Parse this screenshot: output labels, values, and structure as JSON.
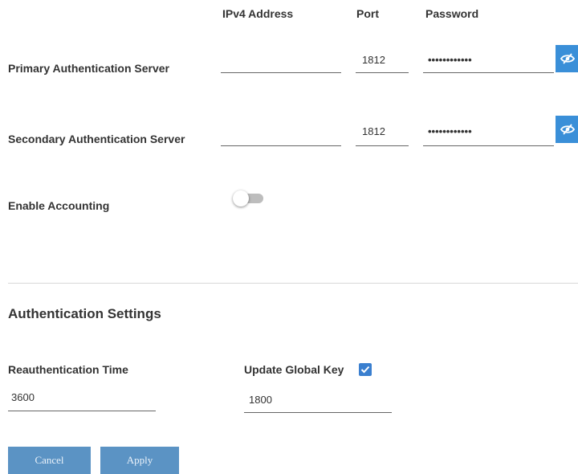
{
  "headers": {
    "ipv4": "IPv4 Address",
    "port": "Port",
    "password": "Password"
  },
  "primary": {
    "label": "Primary Authentication Server",
    "ipv4": "",
    "port": "1812",
    "password": "••••••••••••"
  },
  "secondary": {
    "label": "Secondary Authentication Server",
    "ipv4": "",
    "port": "1812",
    "password": "••••••••••••"
  },
  "accounting": {
    "label": "Enable Accounting",
    "enabled": false
  },
  "auth_settings": {
    "title": "Authentication Settings",
    "reauth_label": "Reauthentication Time",
    "reauth_value": "3600",
    "global_key_label": "Update Global Key",
    "global_key_checked": true,
    "global_key_value": "1800"
  },
  "buttons": {
    "cancel": "Cancel",
    "apply": "Apply"
  },
  "colors": {
    "accent": "#3a8fd8",
    "button": "#5b93c4"
  },
  "icons": {
    "password_toggle": "eye-slash-icon",
    "checkbox": "checkmark-icon"
  }
}
